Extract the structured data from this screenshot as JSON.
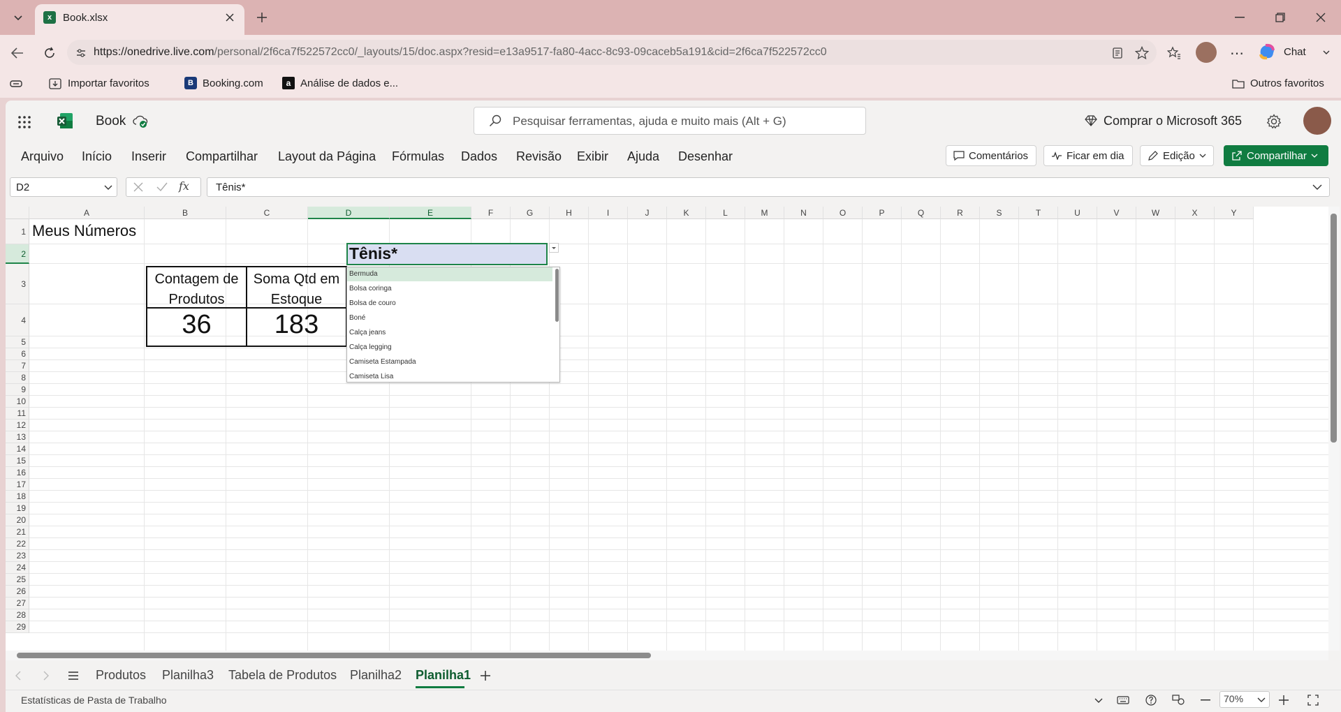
{
  "browser": {
    "tab_title": "Book.xlsx",
    "url_host": "https://onedrive.live.com",
    "url_path": "/personal/2f6ca7f522572cc0/_layouts/15/doc.aspx?resid=e13a9517-fa80-4acc-8c93-09caceb5a191&cid=2f6ca7f522572cc0",
    "chat_label": "Chat",
    "bookmarks": [
      "Importar favoritos",
      "Booking.com",
      "Análise de dados e..."
    ],
    "other_favorites": "Outros favoritos"
  },
  "excel": {
    "doc_name": "Book",
    "search_placeholder": "Pesquisar ferramentas, ajuda e muito mais (Alt + G)",
    "buy_label": "Comprar o Microsoft 365",
    "menu": [
      "Arquivo",
      "Início",
      "Inserir",
      "Compartilhar",
      "Layout da Página",
      "Fórmulas",
      "Dados",
      "Revisão",
      "Exibir",
      "Ajuda",
      "Desenhar"
    ],
    "comments_label": "Comentários",
    "catch_up_label": "Ficar em dia",
    "editing_label": "Edição",
    "share_label": "Compartilhar",
    "name_box": "D2",
    "formula": "Tênis*",
    "fx": "fx"
  },
  "grid": {
    "columns": [
      "A",
      "B",
      "C",
      "D",
      "E",
      "F",
      "G",
      "H",
      "I",
      "J",
      "K",
      "L",
      "M",
      "N",
      "O",
      "P",
      "Q",
      "R",
      "S",
      "T",
      "U",
      "V",
      "W",
      "X",
      "Y"
    ],
    "rows": [
      "1",
      "2",
      "3",
      "4",
      "5",
      "6",
      "7",
      "8",
      "9",
      "10",
      "11",
      "12",
      "13",
      "14",
      "15",
      "16",
      "17",
      "18",
      "19",
      "20",
      "21",
      "22",
      "23",
      "24",
      "25",
      "26",
      "27",
      "28",
      "29"
    ],
    "a1": "Meus Números",
    "d2": "Tênis*",
    "b3": [
      "Contagem de",
      "Produtos"
    ],
    "c3": [
      "Soma Qtd em",
      "Estoque"
    ],
    "b4": "36",
    "c4": "183",
    "dropdown": [
      "Bermuda",
      "Bolsa coringa",
      "Bolsa de couro",
      "Boné",
      "Calça jeans",
      "Calça legging",
      "Camiseta Estampada",
      "Camiseta Lisa"
    ]
  },
  "sheets": [
    "Produtos",
    "Planilha3",
    "Tabela de Produtos",
    "Planilha2",
    "Planilha1"
  ],
  "active_sheet": "Planilha1",
  "status": {
    "left": "Estatísticas de Pasta de Trabalho",
    "zoom": "70%"
  },
  "colors": {
    "accent": "#107c41",
    "selection": "#d9def2"
  }
}
